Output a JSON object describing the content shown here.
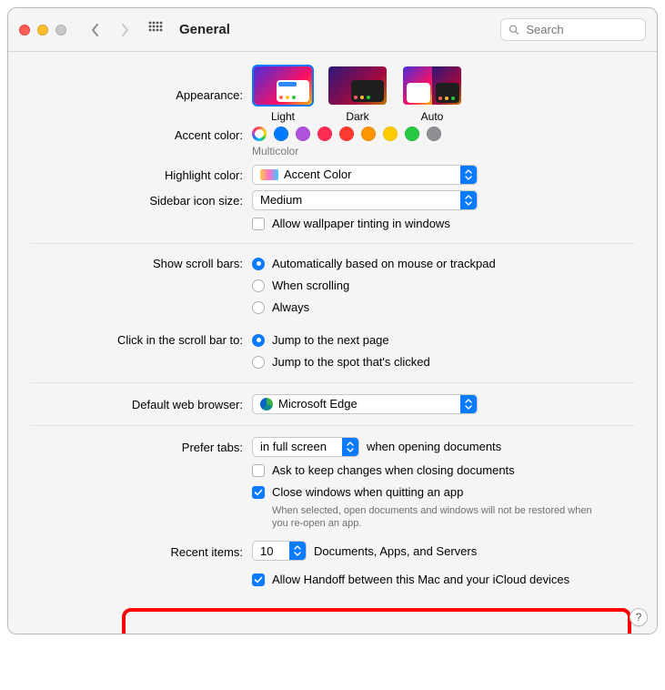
{
  "window": {
    "title": "General"
  },
  "search": {
    "placeholder": "Search"
  },
  "appearance": {
    "label": "Appearance:",
    "options": [
      "Light",
      "Dark",
      "Auto"
    ],
    "selected": "Light"
  },
  "accent": {
    "label": "Accent color:",
    "caption": "Multicolor",
    "colors": [
      "multicolor",
      "#007aff",
      "#af52de",
      "#ff2d55",
      "#ff3b30",
      "#ff9500",
      "#ffcc00",
      "#28c840",
      "#8e8e93"
    ]
  },
  "highlight": {
    "label": "Highlight color:",
    "value": "Accent Color"
  },
  "sidebar": {
    "label": "Sidebar icon size:",
    "value": "Medium"
  },
  "wallpaper": {
    "label": "Allow wallpaper tinting in windows",
    "checked": false
  },
  "scrollbars": {
    "label": "Show scroll bars:",
    "options": [
      {
        "label": "Automatically based on mouse or trackpad",
        "selected": true
      },
      {
        "label": "When scrolling",
        "selected": false
      },
      {
        "label": "Always",
        "selected": false
      }
    ]
  },
  "scrollclick": {
    "label": "Click in the scroll bar to:",
    "options": [
      {
        "label": "Jump to the next page",
        "selected": true
      },
      {
        "label": "Jump to the spot that's clicked",
        "selected": false
      }
    ]
  },
  "browser": {
    "label": "Default web browser:",
    "value": "Microsoft Edge"
  },
  "tabs": {
    "label": "Prefer tabs:",
    "value": "in full screen",
    "suffix": "when opening documents"
  },
  "askChanges": {
    "label": "Ask to keep changes when closing documents",
    "checked": false
  },
  "closeWindows": {
    "label": "Close windows when quitting an app",
    "note": "When selected, open documents and windows will not be restored when you re-open an app.",
    "checked": true
  },
  "recent": {
    "label": "Recent items:",
    "value": "10",
    "suffix": "Documents, Apps, and Servers"
  },
  "handoff": {
    "label": "Allow Handoff between this Mac and your iCloud devices",
    "checked": true
  }
}
